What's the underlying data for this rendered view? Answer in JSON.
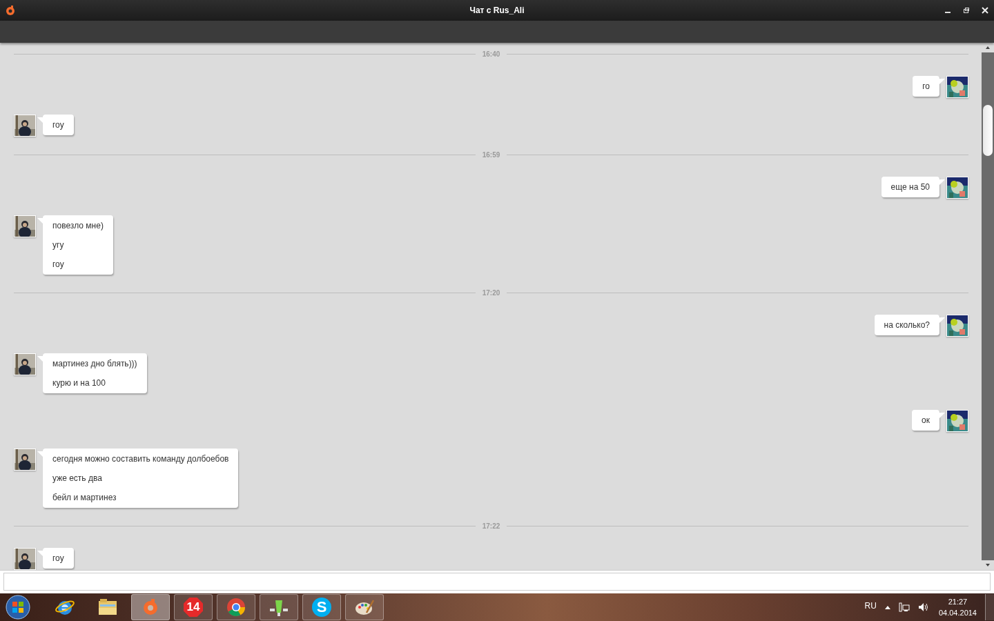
{
  "window": {
    "title": "Чат с Rus_Ali"
  },
  "chat": [
    {
      "kind": "time",
      "text": "16:40"
    },
    {
      "kind": "message",
      "outgoing": true,
      "lines": [
        "го"
      ]
    },
    {
      "kind": "message",
      "outgoing": false,
      "lines": [
        "гоу"
      ]
    },
    {
      "kind": "time",
      "text": "16:59"
    },
    {
      "kind": "message",
      "outgoing": true,
      "lines": [
        "еще на 50"
      ]
    },
    {
      "kind": "message",
      "outgoing": false,
      "lines": [
        "повезло мне)",
        "угу",
        "гоу"
      ]
    },
    {
      "kind": "time",
      "text": "17:20"
    },
    {
      "kind": "message",
      "outgoing": true,
      "lines": [
        "на сколько?"
      ]
    },
    {
      "kind": "message",
      "outgoing": false,
      "lines": [
        "мартинез дно блять)))",
        "курю и на 100"
      ]
    },
    {
      "kind": "message",
      "outgoing": true,
      "lines": [
        "ок"
      ]
    },
    {
      "kind": "message",
      "outgoing": false,
      "lines": [
        "сегодня можно составить команду долбоебов",
        "уже есть два",
        "бейл и мартинез"
      ]
    },
    {
      "kind": "time",
      "text": "17:22"
    },
    {
      "kind": "message",
      "outgoing": false,
      "lines": [
        "гоу"
      ]
    }
  ],
  "taskbar": {
    "apps": [
      {
        "kind": "ie",
        "selected": false
      },
      {
        "kind": "folder",
        "selected": false
      },
      {
        "kind": "origin",
        "selected": true
      },
      {
        "kind": "badge",
        "label": "14",
        "selected": false
      },
      {
        "kind": "chrome",
        "selected": false
      },
      {
        "kind": "green",
        "selected": false
      },
      {
        "kind": "skype",
        "label": "S",
        "selected": false
      },
      {
        "kind": "paint",
        "selected": false
      }
    ],
    "language": "RU",
    "time": "21:27",
    "date": "04.04.2014"
  }
}
